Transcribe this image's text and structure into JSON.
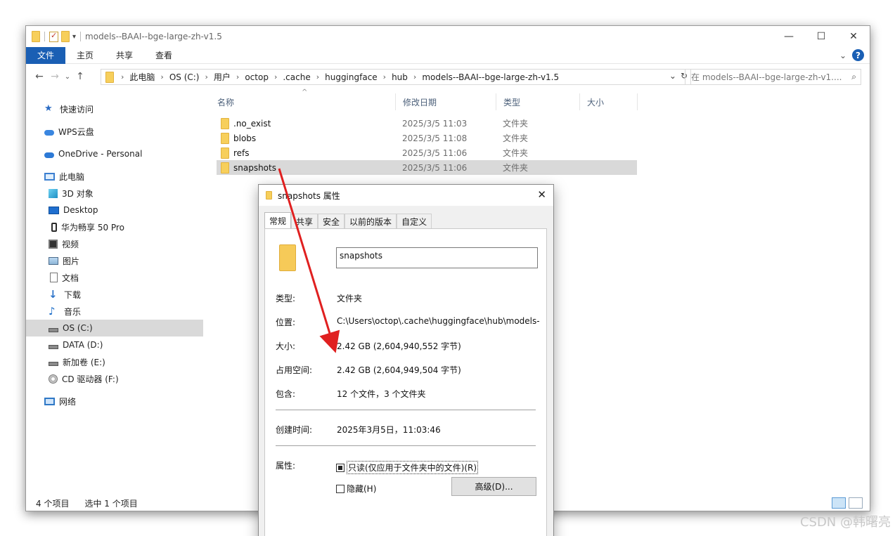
{
  "titlebar": {
    "title": "models--BAAI--bge-large-zh-v1.5",
    "controls": {
      "minimize": "—",
      "maximize": "☐",
      "close": "✕"
    }
  },
  "ribbon": {
    "tabs": [
      "文件",
      "主页",
      "共享",
      "查看"
    ],
    "expand_icon": "chevron-down-icon",
    "help_label": "?"
  },
  "navigation": {
    "back": "←",
    "forward": "→",
    "recent": "⌄",
    "up": "↑",
    "breadcrumb": [
      "此电脑",
      "OS (C:)",
      "用户",
      "octop",
      ".cache",
      "huggingface",
      "hub",
      "models--BAAI--bge-large-zh-v1.5"
    ],
    "dropdown": "⌄",
    "refresh": "↻",
    "search_placeholder": "在 models--BAAI--bge-large-zh-v1....",
    "search_icon": "⌕"
  },
  "sidebar": {
    "items": [
      {
        "label": "快速访问",
        "icon": "star-icon"
      },
      {
        "label": "WPS云盘",
        "icon": "cloud-icon"
      },
      {
        "label": "OneDrive - Personal",
        "icon": "onedrive-icon"
      },
      {
        "label": "此电脑",
        "icon": "computer-icon"
      },
      {
        "label": "3D 对象",
        "icon": "cube-icon"
      },
      {
        "label": "Desktop",
        "icon": "desktop-icon"
      },
      {
        "label": "华为畅享 50 Pro",
        "icon": "phone-icon"
      },
      {
        "label": "视频",
        "icon": "video-icon"
      },
      {
        "label": "图片",
        "icon": "picture-icon"
      },
      {
        "label": "文档",
        "icon": "document-icon"
      },
      {
        "label": "下载",
        "icon": "download-icon"
      },
      {
        "label": "音乐",
        "icon": "music-icon"
      },
      {
        "label": "OS (C:)",
        "icon": "drive-icon",
        "selected": true
      },
      {
        "label": "DATA (D:)",
        "icon": "drive-icon"
      },
      {
        "label": "新加卷 (E:)",
        "icon": "drive-icon"
      },
      {
        "label": "CD 驱动器 (F:)",
        "icon": "cd-drive-icon"
      },
      {
        "label": "网络",
        "icon": "network-icon"
      }
    ]
  },
  "filelist": {
    "columns": [
      "名称",
      "修改日期",
      "类型",
      "大小"
    ],
    "sort_indicator": "^",
    "rows": [
      {
        "name": ".no_exist",
        "date": "2025/3/5 11:03",
        "type": "文件夹"
      },
      {
        "name": "blobs",
        "date": "2025/3/5 11:08",
        "type": "文件夹"
      },
      {
        "name": "refs",
        "date": "2025/3/5 11:06",
        "type": "文件夹"
      },
      {
        "name": "snapshots",
        "date": "2025/3/5 11:06",
        "type": "文件夹",
        "selected": true
      }
    ]
  },
  "statusbar": {
    "count": "4 个项目",
    "selected": "选中 1 个项目"
  },
  "dialog": {
    "title": "snapshots 属性",
    "close": "✕",
    "tabs": [
      "常规",
      "共享",
      "安全",
      "以前的版本",
      "自定义"
    ],
    "active_tab": "常规",
    "name_value": "snapshots",
    "properties": [
      {
        "label": "类型:",
        "value": "文件夹"
      },
      {
        "label": "位置:",
        "value": "C:\\Users\\octop\\.cache\\huggingface\\hub\\models-"
      },
      {
        "label": "大小:",
        "value": "2.42 GB (2,604,940,552 字节)"
      },
      {
        "label": "占用空间:",
        "value": "2.42 GB (2,604,949,504 字节)"
      },
      {
        "label": "包含:",
        "value": "12 个文件，3 个文件夹"
      }
    ],
    "created_label": "创建时间:",
    "created_value": "2025年3月5日，11:03:46",
    "attributes_label": "属性:",
    "readonly_label": "只读(仅应用于文件夹中的文件)(R)",
    "readonly_state": "mixed",
    "hidden_label": "隐藏(H)",
    "hidden_state": "unchecked",
    "advanced_button": "高级(D)..."
  },
  "annotation": {
    "arrow_color": "#e02020"
  },
  "watermark": "CSDN @韩曙亮"
}
